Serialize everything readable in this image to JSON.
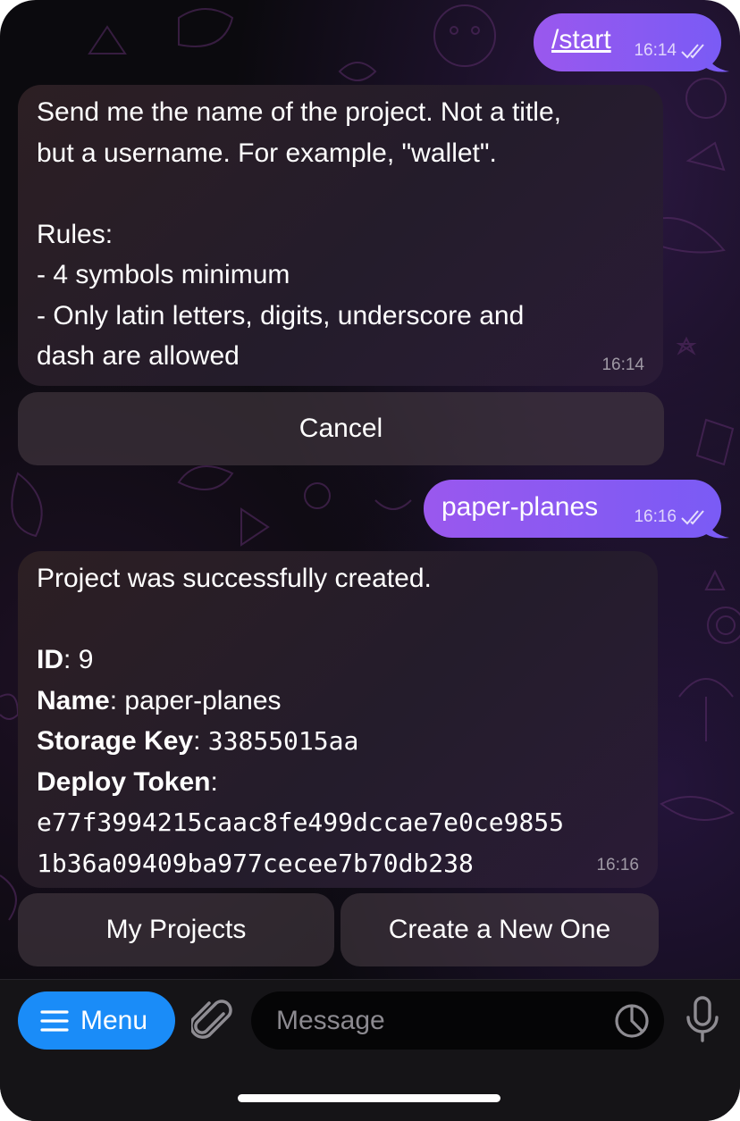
{
  "messages": {
    "start": {
      "text": "/start",
      "time": "16:14"
    },
    "bot_prompt": {
      "lines": [
        "Send me the name of the project. Not a title,",
        "but a username. For example, \"wallet\".",
        "",
        "Rules:",
        "- 4 symbols minimum",
        "- Only latin letters, digits, underscore and",
        "dash are allowed"
      ],
      "time": "16:14"
    },
    "cancel_label": "Cancel",
    "user_reply": {
      "text": "paper-planes",
      "time": "16:16"
    },
    "bot_result": {
      "intro": "Project was successfully created.",
      "id_label": "ID",
      "id_value": "9",
      "name_label": "Name",
      "name_value": "paper-planes",
      "storage_label": "Storage Key",
      "storage_value": "33855015aa",
      "token_label": "Deploy Token",
      "token_line1": "e77f3994215caac8fe499dccae7e0ce9855",
      "token_line2": "1b36a09409ba977cecee7b70db238",
      "separator": ":",
      "time": "16:16"
    },
    "buttons": {
      "my_projects": "My Projects",
      "create_new": "Create a New One"
    }
  },
  "input_bar": {
    "menu_label": "Menu",
    "placeholder": "Message",
    "icons": [
      "menu-lines-icon",
      "paperclip-icon",
      "sticker-icon",
      "microphone-icon"
    ]
  },
  "colors": {
    "outgoing_bubble": "#8b59f2",
    "incoming_bubble": "#271d2c",
    "menu_button": "#1a8cf8",
    "background": "#0b0a0e"
  }
}
